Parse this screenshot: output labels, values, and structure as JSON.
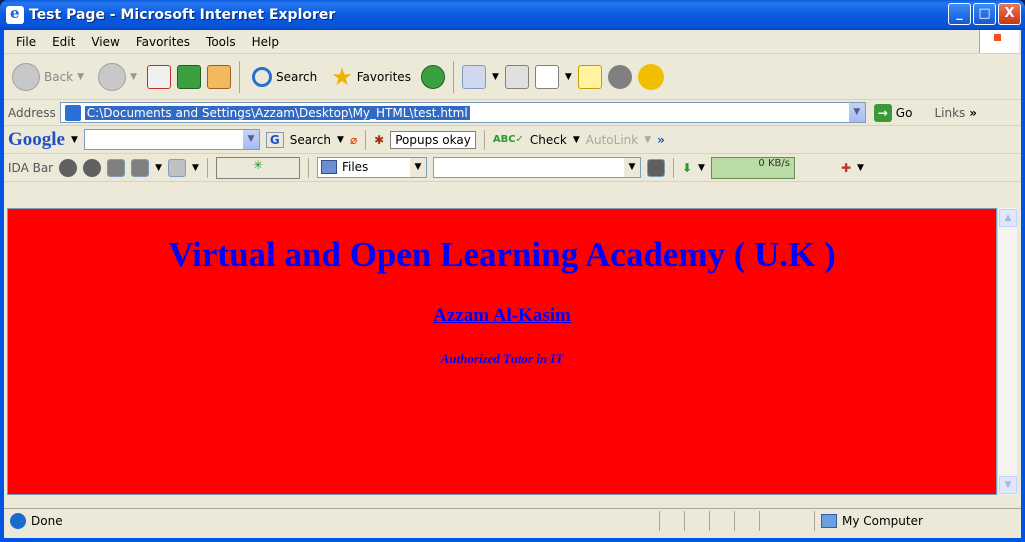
{
  "window": {
    "title": "Test Page - Microsoft Internet Explorer",
    "controls": {
      "minimize": "_",
      "maximize": "□",
      "close": "X"
    }
  },
  "menubar": {
    "items": [
      {
        "label": "File"
      },
      {
        "label": "Edit"
      },
      {
        "label": "View"
      },
      {
        "label": "Favorites"
      },
      {
        "label": "Tools"
      },
      {
        "label": "Help"
      }
    ]
  },
  "toolbar": {
    "back_label": "Back",
    "search_label": "Search",
    "favorites_label": "Favorites"
  },
  "address": {
    "label": "Address",
    "value": "C:\\Documents and Settings\\Azzam\\Desktop\\My_HTML\\test.html",
    "go_label": "Go",
    "links_label": "Links"
  },
  "google_bar": {
    "logo": "Google",
    "search_label": "Search",
    "popups_label": "Popups okay",
    "check_label": "Check",
    "autolink_label": "AutoLink"
  },
  "ida_bar": {
    "label": "IDA Bar",
    "files_label": "Files",
    "speed": "0 KB/s"
  },
  "page": {
    "title": "Virtual and Open Learning Academy ( U.K )",
    "name": "Azzam Al-Kasim",
    "tagline": "Authorized Tutor in IT",
    "background": "#ff0000",
    "text_color": "#0000ff"
  },
  "status": {
    "text": "Done",
    "zone": "My Computer"
  }
}
